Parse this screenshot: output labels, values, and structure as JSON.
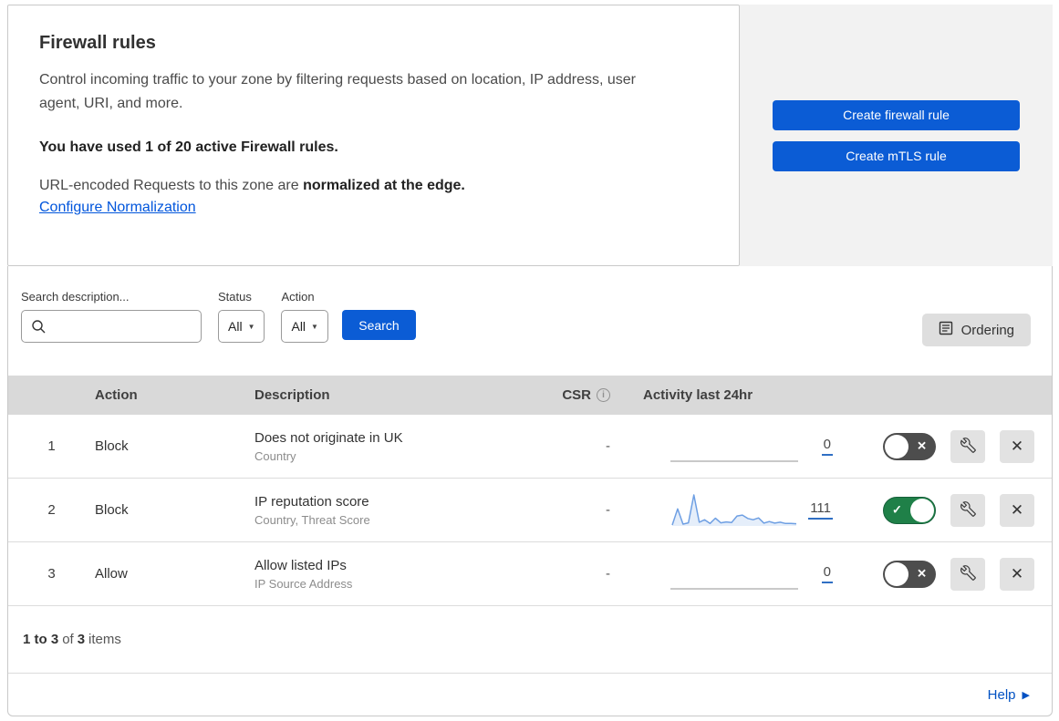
{
  "header": {
    "title": "Firewall rules",
    "description": "Control incoming traffic to your zone by filtering requests based on location, IP address, user agent, URI, and more.",
    "usage_notice": "You have used 1 of 20 active Firewall rules.",
    "normalization_prefix": "URL-encoded Requests to this zone are ",
    "normalization_bold": "normalized at the edge.",
    "normalization_link": "Configure Normalization",
    "create_firewall_button": "Create firewall rule",
    "create_mtls_button": "Create mTLS rule"
  },
  "filters": {
    "search_label": "Search description...",
    "status_label": "Status",
    "status_value": "All",
    "action_label": "Action",
    "action_value": "All",
    "search_button": "Search",
    "ordering_button": "Ordering"
  },
  "table": {
    "columns": {
      "action": "Action",
      "description": "Description",
      "csr": "CSR",
      "activity": "Activity last 24hr"
    },
    "rows": [
      {
        "priority": "1",
        "action": "Block",
        "description": "Does not originate in UK",
        "fields": "Country",
        "csr": "-",
        "activity_count": "0",
        "enabled": false,
        "sparkline": []
      },
      {
        "priority": "2",
        "action": "Block",
        "description": "IP reputation score",
        "fields": "Country, Threat Score",
        "csr": "-",
        "activity_count": "111",
        "enabled": true,
        "sparkline": [
          3,
          55,
          6,
          10,
          100,
          12,
          20,
          8,
          25,
          10,
          13,
          11,
          32,
          35,
          24,
          20,
          26,
          9,
          14,
          9,
          12,
          8,
          8,
          7
        ]
      },
      {
        "priority": "3",
        "action": "Allow",
        "description": "Allow listed IPs",
        "fields": "IP Source Address",
        "csr": "-",
        "activity_count": "0",
        "enabled": false,
        "sparkline": []
      }
    ]
  },
  "footer": {
    "range_bold": "1 to 3",
    "of_text": "of",
    "total_bold": "3",
    "items_text": "items",
    "help_label": "Help"
  },
  "colors": {
    "accent_blue": "#0b5cd5",
    "link_blue": "#0055dc",
    "toggle_on_green": "#1f8048",
    "toggle_off_gray": "#4d4d4d",
    "sparkline_blue": "#6e9fe3",
    "table_header_gray": "#d9d9d9"
  }
}
